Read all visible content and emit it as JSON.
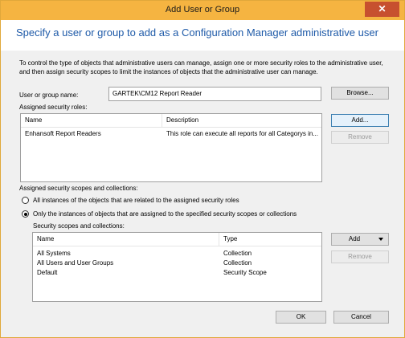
{
  "window": {
    "title": "Add User or Group",
    "close_glyph": "✕"
  },
  "header": {
    "heading": "Specify a user or group to add as a Configuration Manager administrative user"
  },
  "intro": {
    "text": "To control the type of objects that administrative users can manage, assign one or more security roles  to the  administrative user, and then assign security scopes to limit the instances of objects that the administrative user can manage."
  },
  "user": {
    "label": "User or group name:",
    "value": "GARTEK\\CM12 Report Reader",
    "browse_label": "Browse..."
  },
  "roles": {
    "label": "Assigned security roles:",
    "columns": [
      "Name",
      "Description"
    ],
    "rows": [
      {
        "name": "Enhansoft Report Readers",
        "description": "This role can execute all reports for all Categorys in..."
      }
    ],
    "add_label": "Add...",
    "remove_label": "Remove"
  },
  "scopes_section": {
    "label": "Assigned security scopes and collections:",
    "option_all": "All instances of the objects that are related to the assigned security roles",
    "option_only": "Only the instances of objects that are assigned to the specified security scopes or collections",
    "selected": "only"
  },
  "scopes": {
    "label": "Security scopes and collections:",
    "columns": [
      "Name",
      "Type"
    ],
    "rows": [
      {
        "name": "All Systems",
        "type": "Collection"
      },
      {
        "name": "All Users and User Groups",
        "type": "Collection"
      },
      {
        "name": "Default",
        "type": "Security Scope"
      }
    ],
    "add_label": "Add",
    "remove_label": "Remove"
  },
  "footer": {
    "ok_label": "OK",
    "cancel_label": "Cancel"
  },
  "colors": {
    "titlebar": "#f5b441",
    "close": "#c7502f",
    "heading": "#1e5aa8"
  }
}
